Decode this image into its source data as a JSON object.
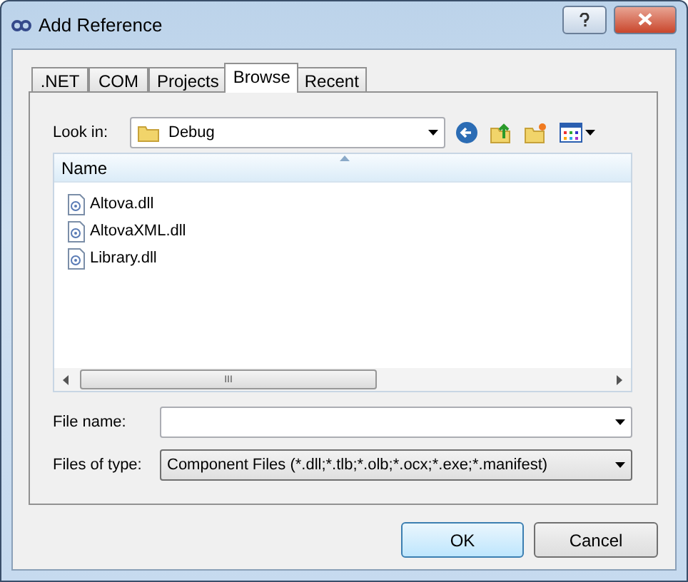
{
  "window": {
    "title": "Add Reference"
  },
  "tabs": [
    {
      "label": ".NET",
      "selected": false
    },
    {
      "label": "COM",
      "selected": false
    },
    {
      "label": "Projects",
      "selected": false
    },
    {
      "label": "Browse",
      "selected": true
    },
    {
      "label": "Recent",
      "selected": false
    }
  ],
  "look_in": {
    "label": "Look in:",
    "value": "Debug"
  },
  "file_list": {
    "columns": [
      "Name"
    ],
    "files": [
      "Altova.dll",
      "AltovaXML.dll",
      "Library.dll"
    ],
    "scroll_grip": "III"
  },
  "file_name": {
    "label": "File name:"
  },
  "files_of_type": {
    "label": "Files of type:",
    "value": "Component Files (*.dll;*.tlb;*.olb;*.ocx;*.exe;*.manifest)"
  },
  "buttons": [
    "OK",
    "Cancel"
  ]
}
